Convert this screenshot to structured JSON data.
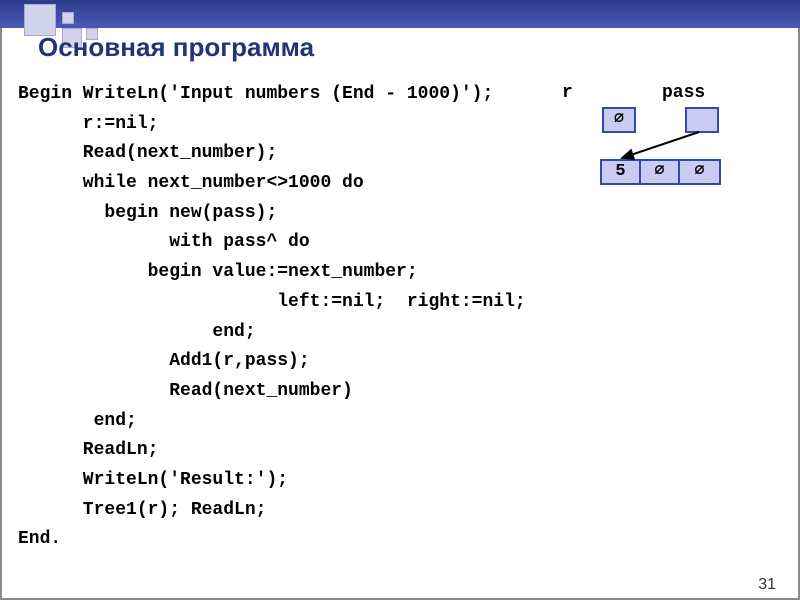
{
  "title": "Основная программа",
  "code": "Begin WriteLn('Input numbers (End - 1000)');\n      r:=nil;\n      Read(next_number);\n      while next_number<>1000 do\n        begin new(pass);\n              with pass^ do\n            begin value:=next_number;\n                        left:=nil;  right:=nil;\n                  end;\n              Add1(r,pass);\n              Read(next_number)\n       end;\n      ReadLn;\n      WriteLn('Result:');\n      Tree1(r); ReadLn;\nEnd.",
  "diagram": {
    "r_label": "r",
    "pass_label": "pass",
    "empty": "∅",
    "node_value": "5"
  },
  "page_number": "31"
}
